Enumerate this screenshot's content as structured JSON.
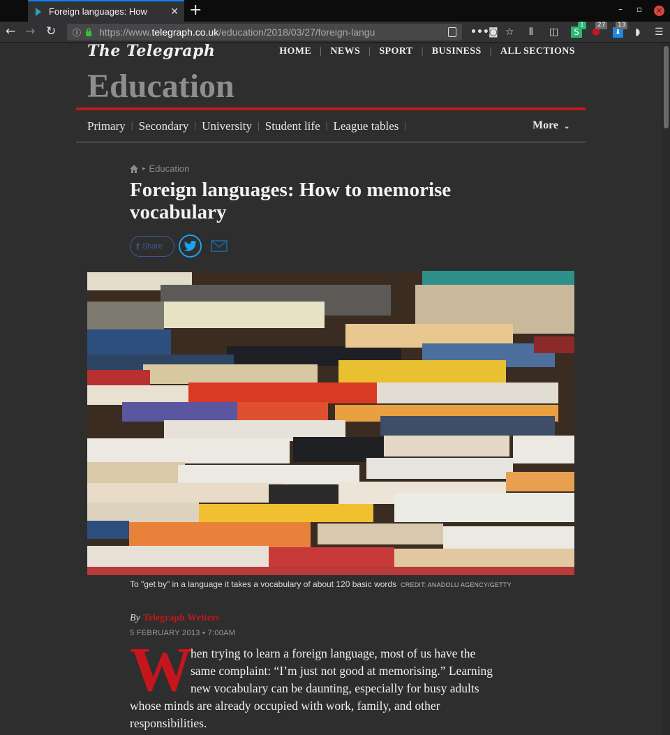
{
  "browser": {
    "tab_title": "Foreign languages: How",
    "url_prefix": "https://www.",
    "url_domain": "telegraph.co.uk",
    "url_path": "/education/2018/03/27/foreign-langu",
    "badges": [
      "1",
      "27",
      "13"
    ]
  },
  "header": {
    "logo": "The Telegraph",
    "nav": [
      "HOME",
      "NEWS",
      "SPORT",
      "BUSINESS",
      "ALL SECTIONS"
    ],
    "section": "Education",
    "subnav": [
      "Primary",
      "Secondary",
      "University",
      "Student life",
      "League tables"
    ],
    "more": "More"
  },
  "article": {
    "breadcrumb": "Education",
    "headline": "Foreign languages: How to memorise vocabulary",
    "share_label": "Share",
    "caption": "To \"get by\" in a language it takes a vocabulary of about 120 basic words",
    "credit": "CREDIT: ANADOLU AGENCY/GETTY",
    "by": "By",
    "author": "Telegraph Writers",
    "date": "5 FEBRUARY 2013 • 7:00AM",
    "dropcap": "W",
    "body_lines": [
      "hen trying to learn a foreign language, most of us have the",
      "same complaint: “I’m just not good at memorising.” Learning",
      "new vocabulary can be daunting, especially for busy adults",
      "whose minds are already occupied with work, family, and other",
      "responsibilities."
    ]
  },
  "colors": {
    "accent_red": "#c4161c",
    "twitter_blue": "#1da1f2",
    "facebook_blue": "#3b5998",
    "page_bg": "#2e2e2e"
  }
}
